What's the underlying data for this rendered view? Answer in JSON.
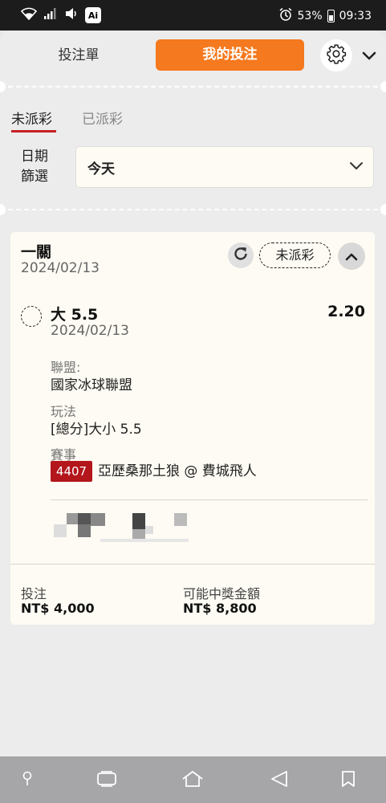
{
  "status_bar": {
    "ai_badge": "Ai",
    "battery_percent": "53%",
    "time": "09:33"
  },
  "header": {
    "tab_betslip": "投注單",
    "tab_mybets": "我的投注",
    "accent_color": "#f5791f"
  },
  "subtabs": {
    "unsettled": "未派彩",
    "settled": "已派彩"
  },
  "date_filter": {
    "label": "日期篩選",
    "value": "今天"
  },
  "bet": {
    "type": "一關",
    "date": "2024/02/13",
    "status": "未派彩",
    "selection": {
      "name": "大 5.5",
      "odds": "2.20",
      "date": "2024/02/13",
      "league_label": "聯盟:",
      "league": "國家冰球聯盟",
      "market_label": "玩法",
      "market": "[總分]大小 5.5",
      "event_label": "賽事",
      "event_id": "4407",
      "event_name": "亞歷桑那土狼 @ 費城飛人"
    },
    "stake_label": "投注",
    "stake": "NT$ 4,000",
    "payout_label": "可能中獎金額",
    "payout": "NT$ 8,800"
  },
  "icons": [
    "wifi-icon",
    "signal-icon",
    "volume-icon",
    "alarm-icon",
    "battery-icon",
    "gear-icon",
    "chevron-down-icon",
    "refresh-icon",
    "chevron-up-icon",
    "pin-icon",
    "recent-apps-icon",
    "home-icon",
    "back-icon",
    "bookmark-icon"
  ]
}
